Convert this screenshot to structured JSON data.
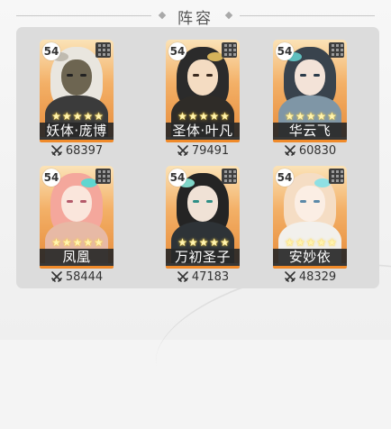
{
  "header": {
    "title": "阵容"
  },
  "lineup": [
    {
      "level": "54",
      "name": "妖体·庞博",
      "power": "68397",
      "stars": 5,
      "colors": {
        "hair": "#e9e6df",
        "face": "#6d6551",
        "body": "#3b3b3b",
        "ornament": "#c0bbb0",
        "eye": "#222222"
      }
    },
    {
      "level": "54",
      "name": "圣体·叶凡",
      "power": "79491",
      "stars": 5,
      "colors": {
        "hair": "#2b2b2b",
        "face": "#f4dcc2",
        "body": "#2f2c28",
        "ornament": "#d6b35a",
        "eye": "#3a2a1f"
      }
    },
    {
      "level": "54",
      "name": "华云飞",
      "power": "60830",
      "stars": 5,
      "colors": {
        "hair": "#39434d",
        "face": "#f3e3d8",
        "body": "#7f96a6",
        "ornament": "#5fbfbf",
        "eye": "#2a3b4a"
      }
    },
    {
      "level": "54",
      "name": "凤凰",
      "power": "58444",
      "stars": 5,
      "colors": {
        "hair": "#f4a79c",
        "face": "#fae6dc",
        "body": "#e7b9a5",
        "ornament": "#5fd6d0",
        "eye": "#b45a6a"
      }
    },
    {
      "level": "54",
      "name": "万初圣子",
      "power": "47183",
      "stars": 5,
      "colors": {
        "hair": "#242424",
        "face": "#f0e2d6",
        "body": "#2e3337",
        "ornament": "#7fd6c8",
        "eye": "#2f8f86"
      }
    },
    {
      "level": "54",
      "name": "安妙依",
      "power": "48329",
      "stars": 5,
      "colors": {
        "hair": "#f5ddc4",
        "face": "#fbeee4",
        "body": "#f2f0ec",
        "ornament": "#8fe0e4",
        "eye": "#5b89a8"
      }
    }
  ],
  "icons": {
    "power": "crossed-swords-icon",
    "slots": "grid-icon",
    "star": "star-icon"
  },
  "accent_color": "#f08a2a"
}
